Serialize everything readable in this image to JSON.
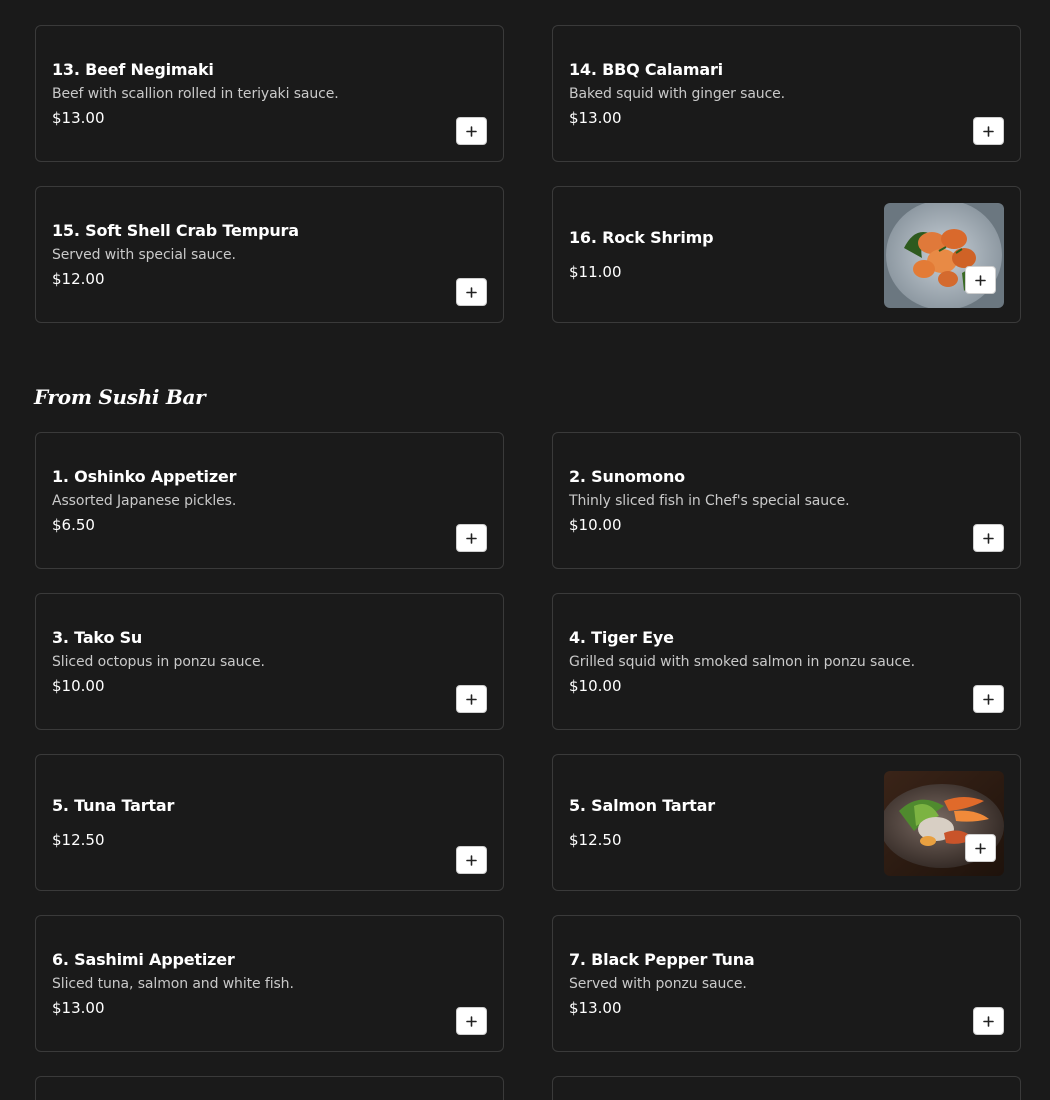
{
  "colors": {
    "background": "#1a1a1a",
    "card_border": "#3a3a3a",
    "text_primary": "#ffffff",
    "text_secondary": "#c9c9c9",
    "button_bg": "#ffffff"
  },
  "add_icon": "plus-icon",
  "top_items": [
    {
      "name": "13. Beef Negimaki",
      "description": "Beef with scallion rolled in teriyaki sauce.",
      "price": "$13.00"
    },
    {
      "name": "14. BBQ Calamari",
      "description": "Baked squid with ginger sauce.",
      "price": "$13.00"
    },
    {
      "name": "15. Soft Shell Crab Tempura",
      "description": "Served with special sauce.",
      "price": "$12.00"
    },
    {
      "name": "16. Rock Shrimp",
      "description": "",
      "price": "$11.00",
      "image": "rock-shrimp-photo"
    }
  ],
  "section": {
    "title": "From Sushi Bar",
    "items": [
      {
        "name": "1. Oshinko Appetizer",
        "description": "Assorted Japanese pickles.",
        "price": "$6.50"
      },
      {
        "name": "2. Sunomono",
        "description": "Thinly sliced fish in Chef's special sauce.",
        "price": "$10.00"
      },
      {
        "name": "3. Tako Su",
        "description": "Sliced octopus in ponzu sauce.",
        "price": "$10.00"
      },
      {
        "name": "4. Tiger Eye",
        "description": "Grilled squid with smoked salmon in ponzu sauce.",
        "price": "$10.00"
      },
      {
        "name": "5. Tuna Tartar",
        "description": "",
        "price": "$12.50"
      },
      {
        "name": "5. Salmon Tartar",
        "description": "",
        "price": "$12.50",
        "image": "salmon-tartar-photo"
      },
      {
        "name": "6. Sashimi Appetizer",
        "description": "Sliced tuna, salmon and white fish.",
        "price": "$13.00"
      },
      {
        "name": "7. Black Pepper Tuna",
        "description": "Served with ponzu sauce.",
        "price": "$13.00"
      }
    ]
  }
}
